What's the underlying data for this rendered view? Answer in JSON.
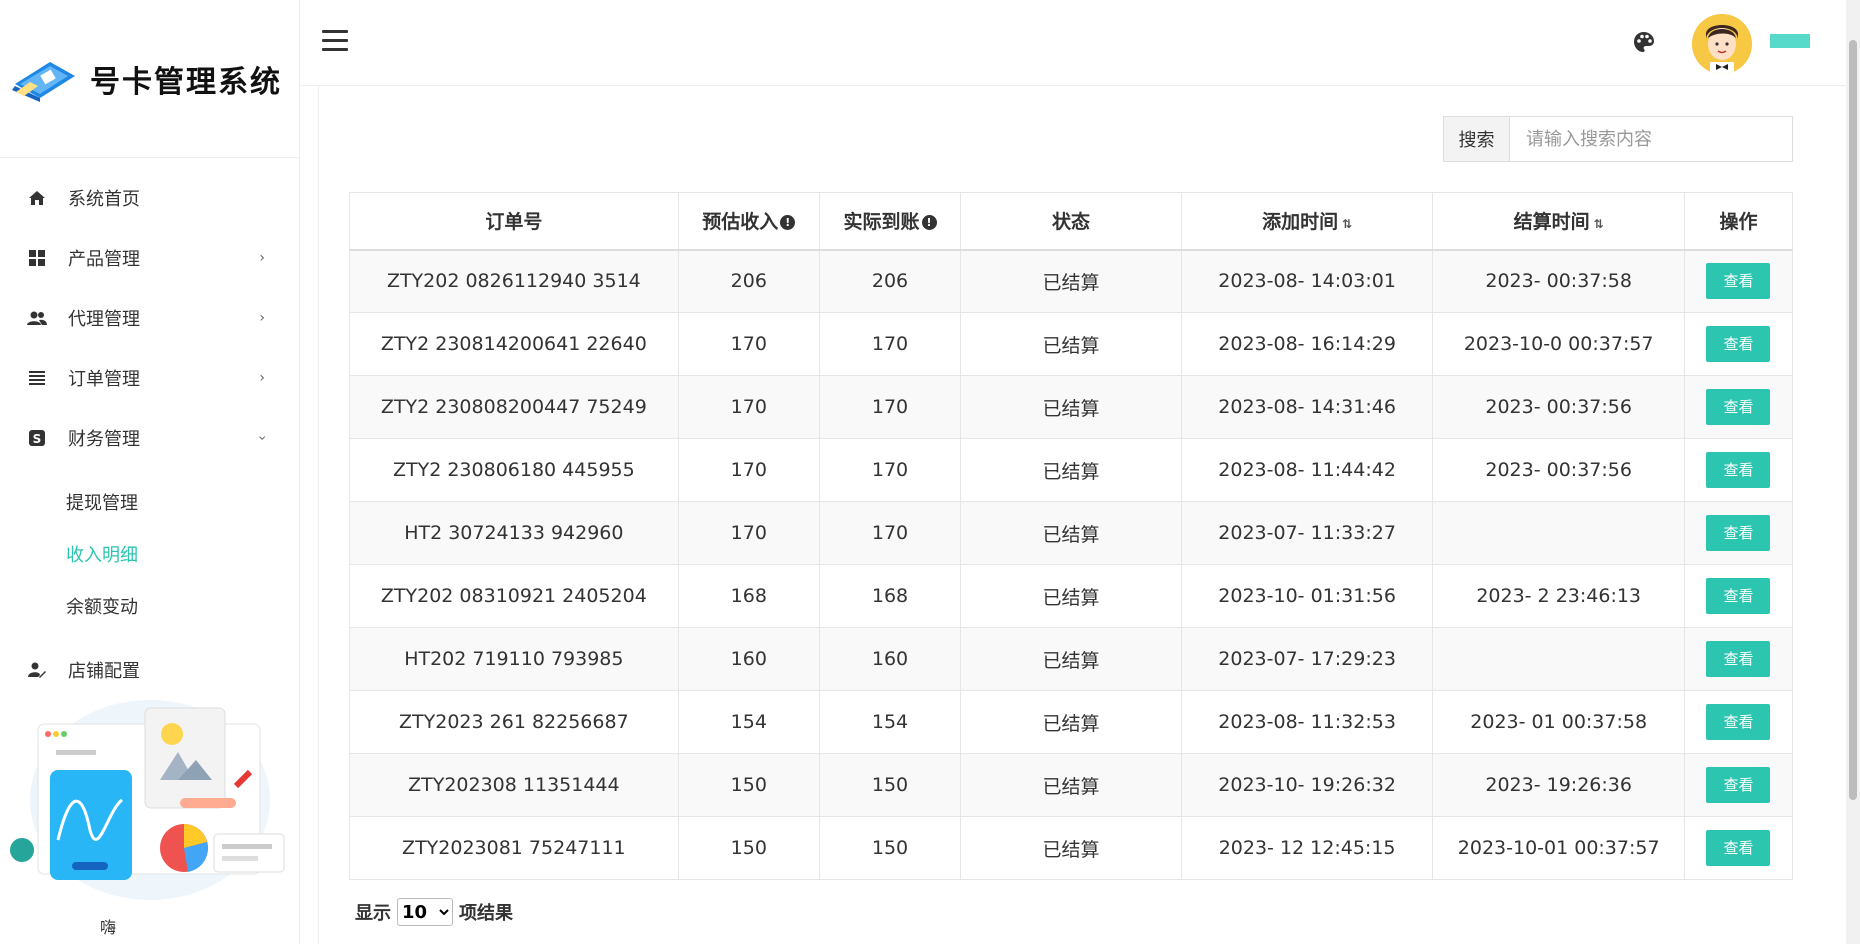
{
  "brand": {
    "title": "号卡管理系统"
  },
  "sidebar": {
    "items": [
      {
        "label": "系统首页",
        "icon": "home-icon"
      },
      {
        "label": "产品管理",
        "icon": "grid-icon",
        "arrow": "›"
      },
      {
        "label": "代理管理",
        "icon": "users-icon",
        "arrow": "›"
      },
      {
        "label": "订单管理",
        "icon": "list-icon",
        "arrow": "›"
      },
      {
        "label": "财务管理",
        "icon": "dollar-icon",
        "arrow": "›"
      }
    ],
    "finance_sub": [
      "提现管理",
      "收入明细",
      "余额变动"
    ],
    "active_sub": "收入明细",
    "store": {
      "label": "店铺配置",
      "icon": "user-edit-icon"
    },
    "promo_text": "嗨"
  },
  "colors": {
    "accent": "#2cc5b0"
  },
  "search": {
    "label": "搜索",
    "placeholder": "请输入搜索内容"
  },
  "table": {
    "headers": [
      "订单号",
      "预估收入",
      "实际到账",
      "状态",
      "添加时间",
      "结算时间",
      "操作"
    ],
    "info_icon": "!",
    "sort_icon": "⇅",
    "button_label": "查看",
    "rows": [
      [
        "ZTY202 0826112940 3514",
        "206",
        "206",
        "已结算",
        "2023-08-   14:03:01",
        "2023-     00:37:58"
      ],
      [
        "ZTY2 230814200641 22640",
        "170",
        "170",
        "已结算",
        "2023-08-   16:14:29",
        "2023-10-0  00:37:57"
      ],
      [
        "ZTY2 230808200447 75249",
        "170",
        "170",
        "已结算",
        "2023-08-   14:31:46",
        "2023-     00:37:56"
      ],
      [
        "ZTY2 230806180 445955",
        "170",
        "170",
        "已结算",
        "2023-08-   11:44:42",
        "2023-     00:37:56"
      ],
      [
        "HT2 30724133  942960",
        "170",
        "170",
        "已结算",
        "2023-07-   11:33:27",
        ""
      ],
      [
        "ZTY202 08310921 2405204",
        "168",
        "168",
        "已结算",
        "2023-10-   01:31:56",
        "2023-     2 23:46:13"
      ],
      [
        "HT202 719110  793985",
        "160",
        "160",
        "已结算",
        "2023-07-   17:29:23",
        ""
      ],
      [
        "ZTY2023 261  82256687",
        "154",
        "154",
        "已结算",
        "2023-08-   11:32:53",
        "2023-   01 00:37:58"
      ],
      [
        "ZTY202308    11351444",
        "150",
        "150",
        "已结算",
        "2023-10-   19:26:32",
        "2023-     19:26:36"
      ],
      [
        "ZTY2023081   75247111",
        "150",
        "150",
        "已结算",
        "2023-   12 12:45:15",
        "2023-10-01 00:37:57"
      ]
    ]
  },
  "pagination": {
    "prefix": "显示",
    "suffix": "项结果",
    "selected": "10",
    "options": [
      "10"
    ]
  }
}
